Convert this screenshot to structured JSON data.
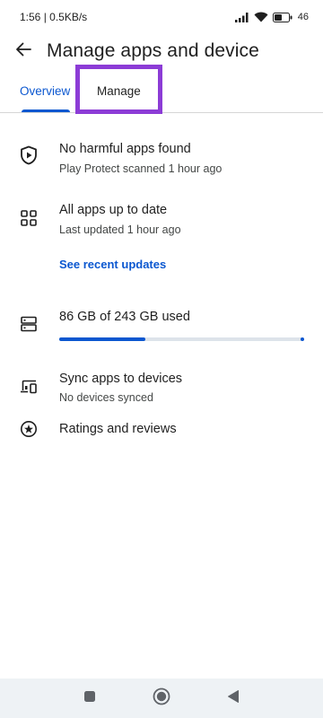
{
  "status_bar": {
    "time_speed": "1:56 | 0.5KB/s",
    "battery": "46"
  },
  "header": {
    "title": "Manage apps and device"
  },
  "tabs": [
    {
      "label": "Overview",
      "selected": true
    },
    {
      "label": "Manage",
      "selected": false
    }
  ],
  "sections": {
    "protect": {
      "title": "No harmful apps found",
      "subtitle": "Play Protect scanned 1 hour ago"
    },
    "updates": {
      "title": "All apps up to date",
      "subtitle": "Last updated 1 hour ago",
      "link": "See recent updates"
    },
    "storage": {
      "title": "86 GB of 243 GB used",
      "used_fraction": 0.354
    },
    "sync": {
      "title": "Sync apps to devices",
      "subtitle": "No devices synced"
    },
    "ratings": {
      "title": "Ratings and reviews"
    }
  },
  "colors": {
    "accent": "#0b57d0",
    "highlight": "#8c3cd6"
  }
}
